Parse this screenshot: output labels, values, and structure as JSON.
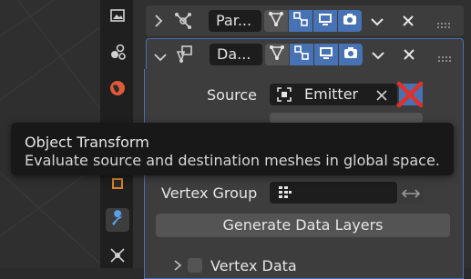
{
  "modifiers": [
    {
      "name": "Par...",
      "expanded": false
    },
    {
      "name": "Da...",
      "expanded": true
    }
  ],
  "data_transfer": {
    "source_label": "Source",
    "source_value": "Emitter",
    "vertex_group_label": "Vertex Group",
    "vertex_group_value": "",
    "generate_button": "Generate Data Layers",
    "vertex_data_label": "Vertex Data"
  },
  "tooltip": {
    "title": "Object Transform",
    "description": "Evaluate source and destination meshes in global space."
  },
  "colors": {
    "accent": "#4772b3",
    "close_x": "#e0302a",
    "wrench": "#5aa0e8",
    "physics": "#e05a3a"
  },
  "icons": [
    "image-icon",
    "physics-icon",
    "world-icon",
    "object-data-icon",
    "modifier-wrench-icon",
    "particles-icon"
  ]
}
